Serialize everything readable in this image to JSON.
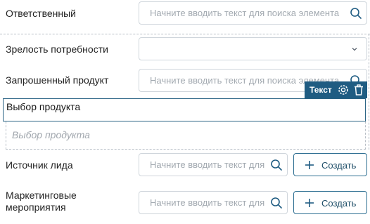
{
  "fields": [
    {
      "label": "Ответственный",
      "placeholder": "Начните вводить текст для поиска элемента"
    },
    {
      "label": "Зрелость потребности",
      "value": ""
    },
    {
      "label": "Запрошенный продукт",
      "placeholder": "Начните вводить текст для поиска элемента"
    },
    {
      "label": "Источник лида",
      "placeholder": "Начните вводить текст для поиска элемента",
      "button": "Создать"
    },
    {
      "label": "Маркетинговые\nмероприятия",
      "label_line1": "Маркетинговые",
      "label_line2": "мероприятия",
      "placeholder": "Начните вводить текст для поиска элемента",
      "button": "Создать"
    }
  ],
  "selected_element": {
    "text": "Выбор продукта",
    "toolbar_label": "Текст"
  },
  "drop_placeholder": "Выбор продукта",
  "colors": {
    "accent": "#1f5c82",
    "border": "#cfd5db",
    "placeholder": "#a2a9b0"
  }
}
